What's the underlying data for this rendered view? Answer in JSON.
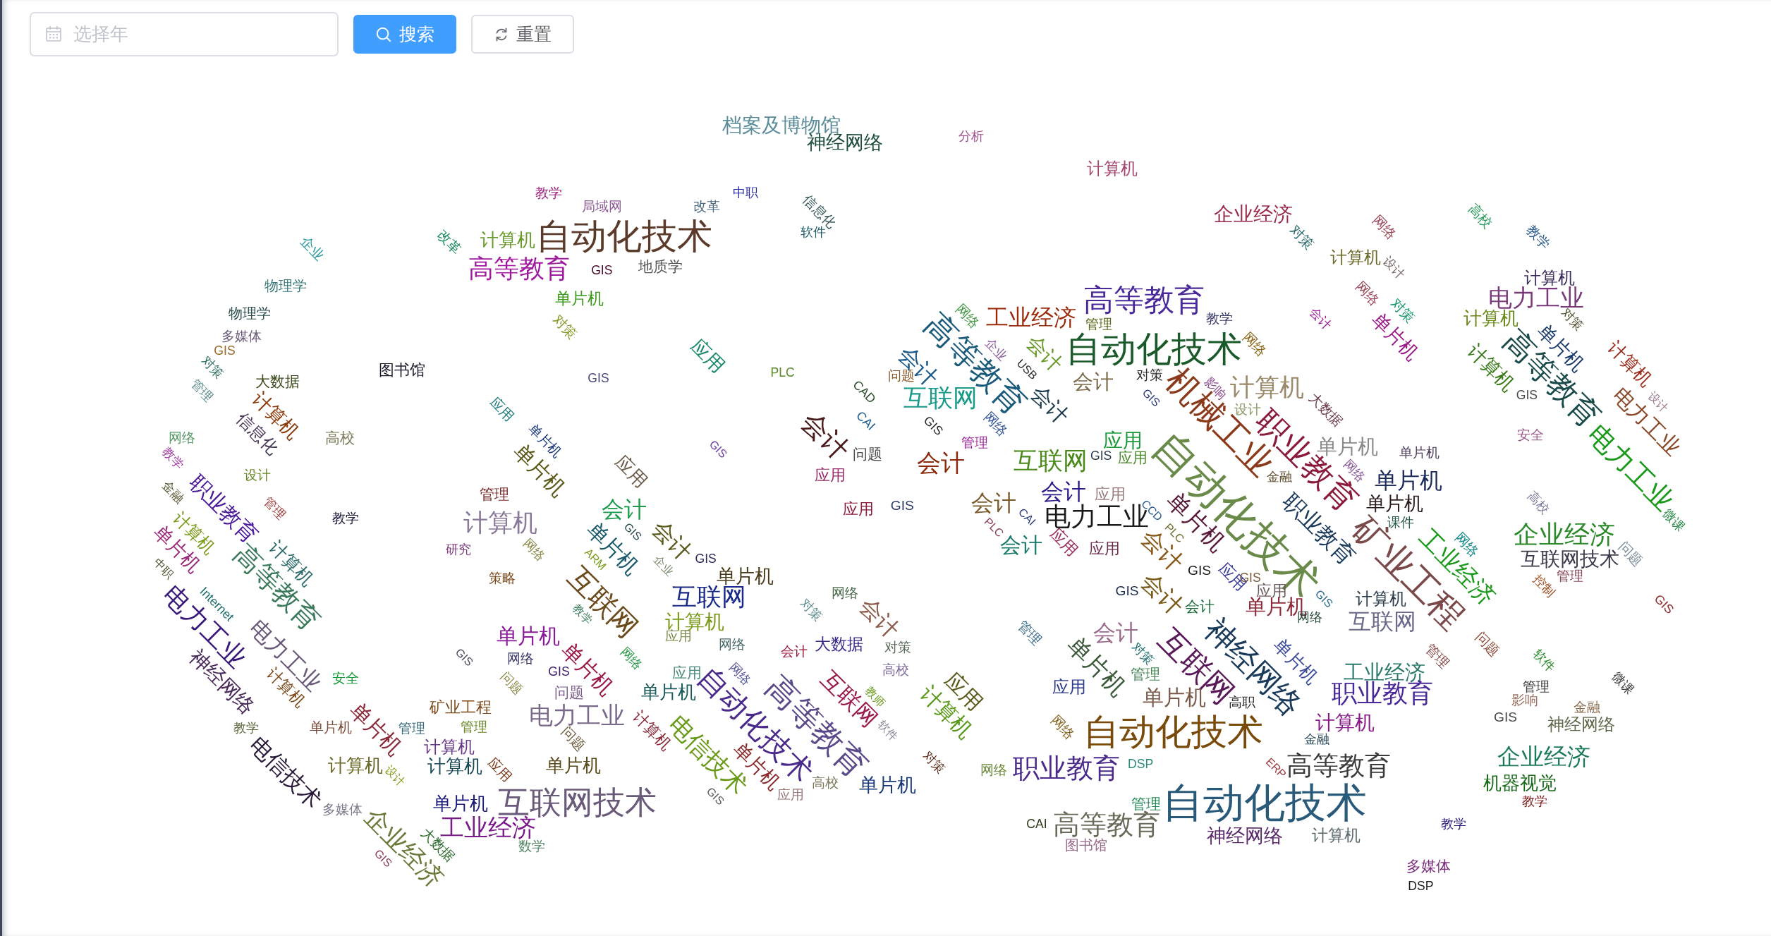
{
  "year_picker": {
    "placeholder": "选择年"
  },
  "search_button": {
    "label": "搜索"
  },
  "reset_button": {
    "label": "重置"
  },
  "word_cloud": {
    "words": [
      "档案及博物馆",
      "神经网络",
      "分析",
      "计算机",
      "教学",
      "中职",
      "局域网",
      "改革",
      "信息化",
      "企业经济",
      "高校",
      "企业",
      "改革",
      "计算机",
      "自动化技术",
      "软件",
      "对策",
      "网络",
      "教学",
      "高等教育",
      "计算机",
      "GIS",
      "地质学",
      "设计",
      "物理学",
      "计算机",
      "单片机",
      "物理学",
      "高等教育",
      "网络",
      "电力工业",
      "对策",
      "网络",
      "工业经济",
      "管理",
      "教学",
      "会计",
      "对策",
      "计算机",
      "对策",
      "多媒体",
      "网络",
      "单片机",
      "GIS",
      "应用",
      "企业",
      "会计",
      "自动化技术",
      "单片机",
      "对策",
      "高等教育",
      "计算机",
      "图书馆",
      "会计",
      "大数据",
      "GIS",
      "PLC",
      "USB",
      "计算机",
      "问题",
      "会计",
      "对策",
      "管理",
      "CAD",
      "影响",
      "高等教育",
      "互联网",
      "计算机",
      "GIS",
      "GIS",
      "应用",
      "会计",
      "设计",
      "设计",
      "计算机",
      "CAI",
      "GIS",
      "网络",
      "机械工业",
      "大数据",
      "电力工业",
      "网络",
      "信息化",
      "高校",
      "单片机",
      "会计",
      "管理",
      "应用",
      "安全",
      "GIS",
      "问题",
      "单片机",
      "教学",
      "会计",
      "互联网",
      "GIS",
      "应用",
      "单片机",
      "职业教育",
      "电力工业",
      "设计",
      "单片机",
      "应用",
      "应用",
      "网络",
      "金融",
      "单片机",
      "金融",
      "管理",
      "会计",
      "教学",
      "会计",
      "应用",
      "GIS",
      "会计",
      "应用",
      "职业教育",
      "管理",
      "CCD",
      "单片机",
      "高校",
      "计算机",
      "CAI",
      "电力工业",
      "PLC",
      "单片机",
      "自动化技术",
      "职业教育",
      "课件",
      "计算机",
      "GIS",
      "PLC",
      "微课",
      "研究",
      "会计",
      "企业经济",
      "单片机",
      "网络",
      "单片机",
      "会计",
      "应用",
      "应用",
      "计算机",
      "ARM",
      "会计",
      "网络",
      "GIS",
      "互联网技术",
      "中职",
      "企业",
      "问题",
      "策略",
      "单片机",
      "GIS",
      "应用",
      "工业经济",
      "GIS",
      "矿业工程",
      "管理",
      "高等教育",
      "互联网",
      "网络",
      "GIS",
      "会计",
      "应用",
      "Internet",
      "互联网",
      "控制",
      "会计",
      "单片机",
      "GIS",
      "计算机",
      "教学",
      "对策",
      "GIS",
      "计算机",
      "会计",
      "网络",
      "电力工业",
      "互联网",
      "单片机",
      "应用",
      "管理",
      "会计",
      "网络",
      "会计",
      "大数据",
      "对策",
      "电力工业",
      "GIS",
      "问题",
      "网络",
      "网络",
      "对策",
      "单片机",
      "管理",
      "软件",
      "GIS",
      "单片机",
      "安全",
      "应用",
      "网络",
      "高校",
      "单片机",
      "互联网",
      "神经网络",
      "管理",
      "工业经济",
      "神经网络",
      "计算机",
      "问题",
      "问题",
      "单片机",
      "应用",
      "应用",
      "矿业工程",
      "单片机",
      "高职",
      "职业教育",
      "管理",
      "互联网",
      "教师",
      "微课",
      "影响",
      "电力工业",
      "计算机",
      "金融",
      "教学",
      "单片机",
      "管理",
      "管理",
      "计算机",
      "自动化技术",
      "计算机",
      "GIS",
      "单片机",
      "计算机",
      "自动化技术",
      "高等教育",
      "软件",
      "网络",
      "神经网络",
      "问题",
      "金融",
      "电信技术",
      "计算机",
      "计算机",
      "应用",
      "单片机",
      "单片机",
      "对策",
      "网络",
      "职业教育",
      "DSP",
      "高等教育",
      "企业经济",
      "电信技术",
      "设计",
      "ERP",
      "高校",
      "单片机",
      "机器视觉",
      "多媒体",
      "单片机",
      "互联网技术",
      "GIS",
      "应用",
      "管理",
      "自动化技术",
      "教学",
      "工业经济",
      "CAI",
      "高等教育",
      "教学",
      "数学",
      "图书馆",
      "神经网络",
      "计算机",
      "企业经济",
      "大数据",
      "GIS",
      "多媒体",
      "DSP"
    ]
  }
}
